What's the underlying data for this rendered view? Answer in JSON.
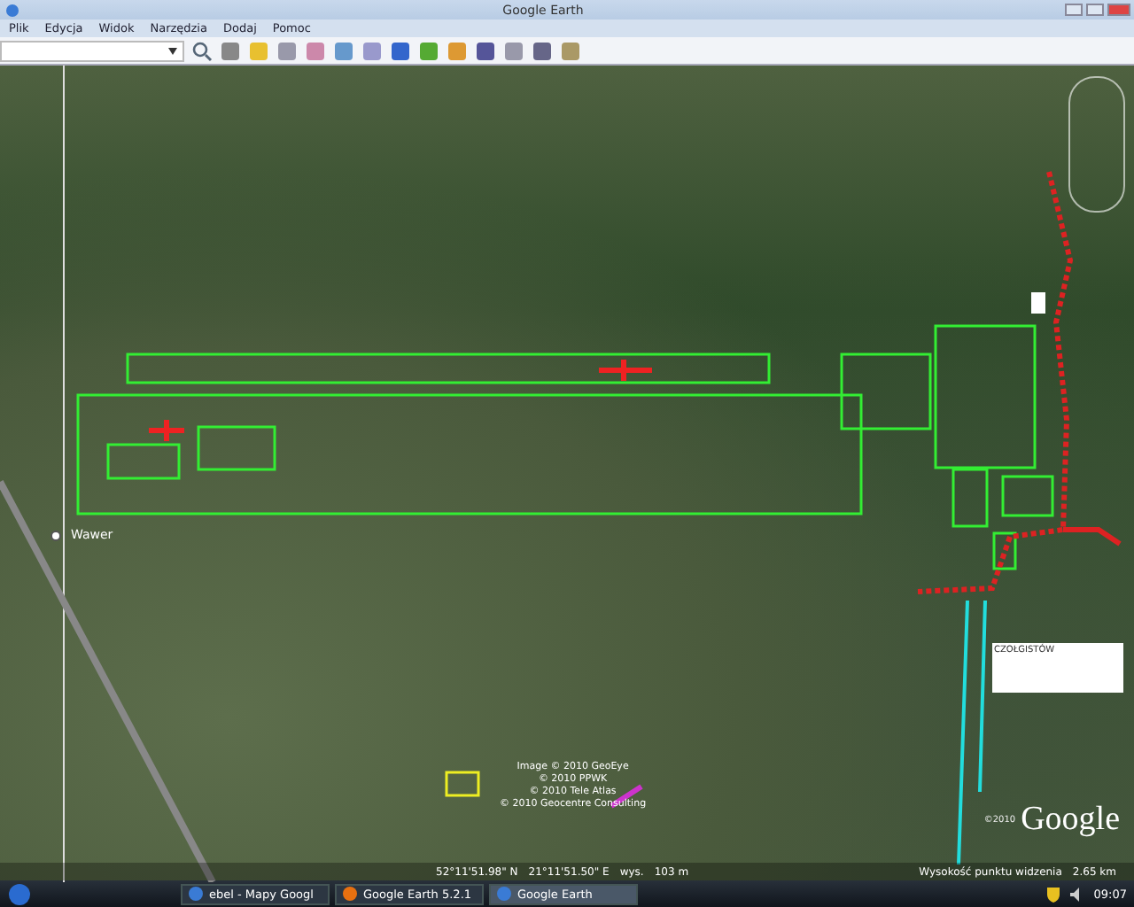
{
  "window": {
    "title": "Google Earth"
  },
  "menu": [
    "Plik",
    "Edycja",
    "Widok",
    "Narzędzia",
    "Dodaj",
    "Pomoc"
  ],
  "map": {
    "place_label": "Wawer",
    "note": "CZOŁGISTÓW",
    "credits": [
      "Image © 2010 GeoEye",
      "© 2010 PPWK",
      "© 2010 Tele Atlas",
      "© 2010 Geocentre Consulting"
    ],
    "logo_year": "©2010",
    "logo": "Google"
  },
  "status_bar": {
    "latitude": "52°11'51.98\" N",
    "longitude": "21°11'51.50\" E",
    "elevation_label": "wys.",
    "elevation": "103 m",
    "eye_label": "Wysokość punktu widzenia",
    "eye_alt": "2.65 km"
  },
  "taskbar": {
    "items": [
      {
        "label": "ebel - Mapy Googl",
        "selected": false
      },
      {
        "label": "Google Earth 5.2.1",
        "selected": false
      },
      {
        "label": "Google Earth",
        "selected": true
      }
    ],
    "time": "09:07"
  }
}
